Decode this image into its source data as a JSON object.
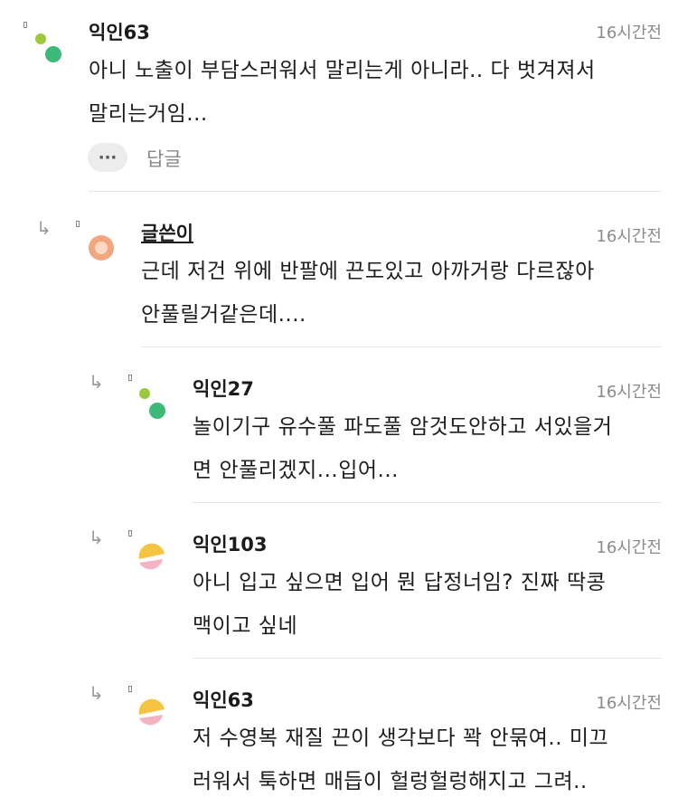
{
  "comments": [
    {
      "author": "익인63",
      "time": "16시간전",
      "line1": "아니 노출이 부담스러워서 말리는게 아니라.. 다 벗겨져서",
      "line2": "말리는거임...",
      "actions": {
        "more": "···",
        "reply": "답글"
      },
      "avatar": {
        "dot_small": "#9cc93b",
        "dot_large": "#3dba78"
      }
    },
    {
      "author": "글쓴이",
      "time": "16시간전",
      "line1": "근데 저건 위에 반팔에 끈도있고 아까거랑 다르잖아",
      "line2": "안풀릴거같은데....",
      "avatar": {
        "ring": "#f2a57e",
        "center": "#fcd7c3"
      }
    },
    {
      "author": "익인27",
      "time": "16시간전",
      "line1": "놀이기구 유수풀 파도풀 암것도안하고 서있을거",
      "line2": "면 안풀리겠지...입어...",
      "avatar": {
        "dot_small": "#9cc93b",
        "dot_large": "#3dba78"
      }
    },
    {
      "author": "익인103",
      "time": "16시간전",
      "line1": "아니 입고 싶으면 입어 뭔 답정너임? 진짜 딱콩",
      "line2": "맥이고 싶네",
      "avatar": {
        "top": "#f5c542",
        "bottom": "#f4b3c2"
      }
    },
    {
      "author": "익인63",
      "time": "16시간전",
      "line1": "저 수영복 재질 끈이 생각보다 꽉 안묶여.. 미끄",
      "line2": "러워서 툭하면 매듭이 헐렁헐렁해지고 그려..",
      "avatar": {
        "top": "#f5c542",
        "bottom": "#f4b3c2"
      }
    }
  ],
  "icons": {
    "reply_arrow": "reply-arrow-icon"
  }
}
